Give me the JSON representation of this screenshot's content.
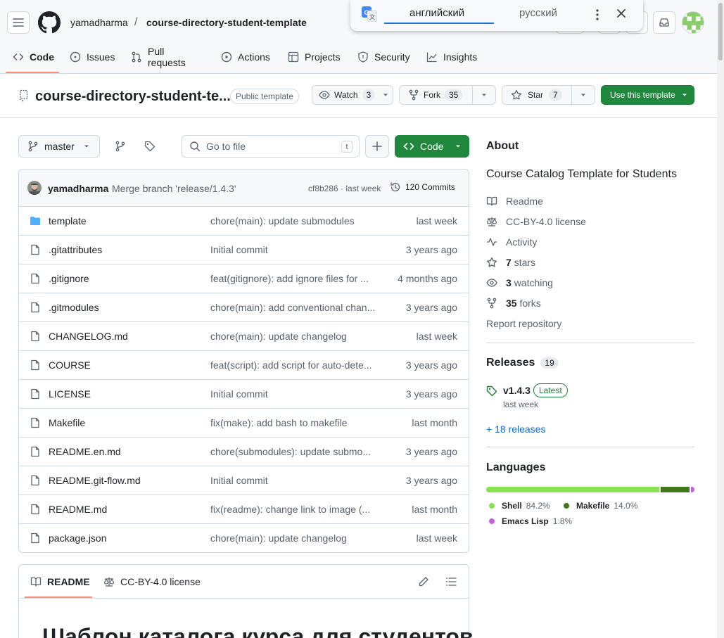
{
  "header": {
    "owner": "yamadharma",
    "separator": "/",
    "repo": "course-directory-student-template"
  },
  "translate_popup": {
    "tab_active": "английский",
    "tab_other": "русский",
    "icon": "google-translate-icon"
  },
  "repo_nav": [
    {
      "label": "Code",
      "icon": "code-icon"
    },
    {
      "label": "Issues",
      "icon": "issue-icon"
    },
    {
      "label": "Pull requests",
      "icon": "pull-request-icon"
    },
    {
      "label": "Actions",
      "icon": "play-icon"
    },
    {
      "label": "Projects",
      "icon": "table-icon"
    },
    {
      "label": "Security",
      "icon": "shield-icon"
    },
    {
      "label": "Insights",
      "icon": "graph-icon"
    }
  ],
  "title_row": {
    "name": "course-directory-student-te...",
    "badge": "Public template",
    "watch_label": "Watch",
    "watch_count": "3",
    "fork_label": "Fork",
    "fork_count": "35",
    "star_label": "Star",
    "star_count": "7",
    "use_template": "Use this template"
  },
  "toolbar": {
    "branch": "master",
    "go_to_file_placeholder": "Go to file",
    "shortcut": "t",
    "code_button": "Code"
  },
  "latest_commit": {
    "author": "yamadharma",
    "message": "Merge branch 'release/1.4.3'",
    "meta": "cf8b286 · last week",
    "commits": "120 Commits"
  },
  "files": [
    {
      "name": "template",
      "type": "folder",
      "message": "chore(main): update submodules",
      "date": "last week"
    },
    {
      "name": ".gitattributes",
      "type": "file",
      "message": "Initial commit",
      "date": "3 years ago"
    },
    {
      "name": ".gitignore",
      "type": "file",
      "message": "feat(gitignore): add ignore files for ...",
      "date": "4 months ago"
    },
    {
      "name": ".gitmodules",
      "type": "file",
      "message": "chore(main): add conventional chan...",
      "date": "3 years ago"
    },
    {
      "name": "CHANGELOG.md",
      "type": "file",
      "message": "chore(main): update changelog",
      "date": "last week"
    },
    {
      "name": "COURSE",
      "type": "file",
      "message": "feat(script): add script for auto-dete...",
      "date": "3 years ago"
    },
    {
      "name": "LICENSE",
      "type": "file",
      "message": "Initial commit",
      "date": "3 years ago"
    },
    {
      "name": "Makefile",
      "type": "file",
      "message": "fix(make): add bash to makefile",
      "date": "last month"
    },
    {
      "name": "README.en.md",
      "type": "file",
      "message": "chore(submodules): update submo...",
      "date": "3 years ago"
    },
    {
      "name": "README.git-flow.md",
      "type": "file",
      "message": "Initial commit",
      "date": "3 years ago"
    },
    {
      "name": "README.md",
      "type": "file",
      "message": "fix(readme): change link to image (...",
      "date": "last month"
    },
    {
      "name": "package.json",
      "type": "file",
      "message": "chore(main): update changelog",
      "date": "last week"
    }
  ],
  "readme": {
    "tab_readme": "README",
    "tab_license": "CC-BY-4.0 license",
    "heading": "Шаблон каталога курса для студентов"
  },
  "about": {
    "title": "About",
    "description": "Course Catalog Template for Students",
    "readme": "Readme",
    "license": "CC-BY-4.0 license",
    "activity": "Activity",
    "stars_count": "7",
    "stars_label": "stars",
    "watching_count": "3",
    "watching_label": "watching",
    "forks_count": "35",
    "forks_label": "forks",
    "report": "Report repository"
  },
  "releases": {
    "title": "Releases",
    "count": "19",
    "tag": "v1.4.3",
    "latest": "Latest",
    "date": "last week",
    "more": "+ 18 releases"
  },
  "languages": {
    "title": "Languages",
    "items": [
      {
        "name": "Shell",
        "percent": "84.2%",
        "value": 84.2,
        "color": "#89e051"
      },
      {
        "name": "Makefile",
        "percent": "14.0%",
        "value": 14.0,
        "color": "#427819"
      },
      {
        "name": "Emacs Lisp",
        "percent": "1.8%",
        "value": 1.8,
        "color": "#c065db"
      }
    ]
  },
  "colors": {
    "accent_green": "#1f883d",
    "link_blue": "#0969da",
    "nav_underline": "#fd8c73",
    "folder": "#54aeff"
  }
}
